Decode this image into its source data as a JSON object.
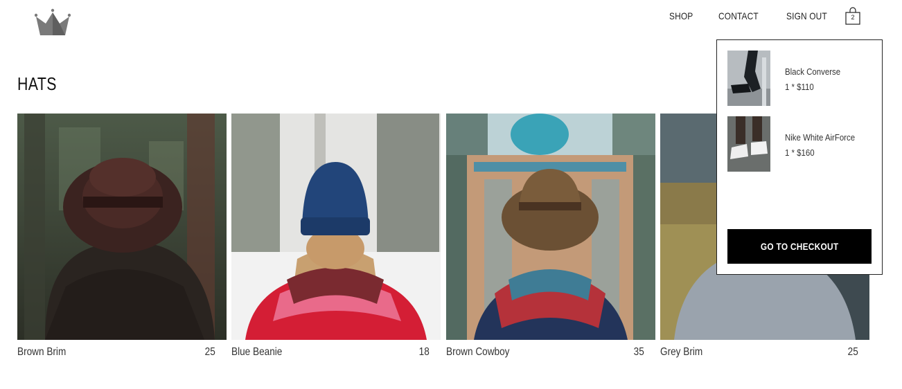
{
  "header": {
    "logo_icon": "crown-icon",
    "nav": [
      {
        "label": "SHOP"
      },
      {
        "label": "CONTACT"
      },
      {
        "label": "SIGN OUT"
      }
    ],
    "cart_icon": "shopping-bag-icon",
    "cart_count": "2"
  },
  "page": {
    "title": "HATS"
  },
  "products": [
    {
      "name": "Brown Brim",
      "price": "25"
    },
    {
      "name": "Blue Beanie",
      "price": "18"
    },
    {
      "name": "Brown Cowboy",
      "price": "35"
    },
    {
      "name": "Grey Brim",
      "price": "25"
    }
  ],
  "cart": {
    "items": [
      {
        "name": "Black Converse",
        "quantity_price": "1 * $110"
      },
      {
        "name": "Nike White AirForce",
        "quantity_price": "1 * $160"
      }
    ],
    "checkout_label": "GO TO CHECKOUT"
  },
  "colors": {
    "background": "#ffffff",
    "text": "#222222",
    "button_bg": "#000000",
    "button_text": "#ffffff"
  }
}
